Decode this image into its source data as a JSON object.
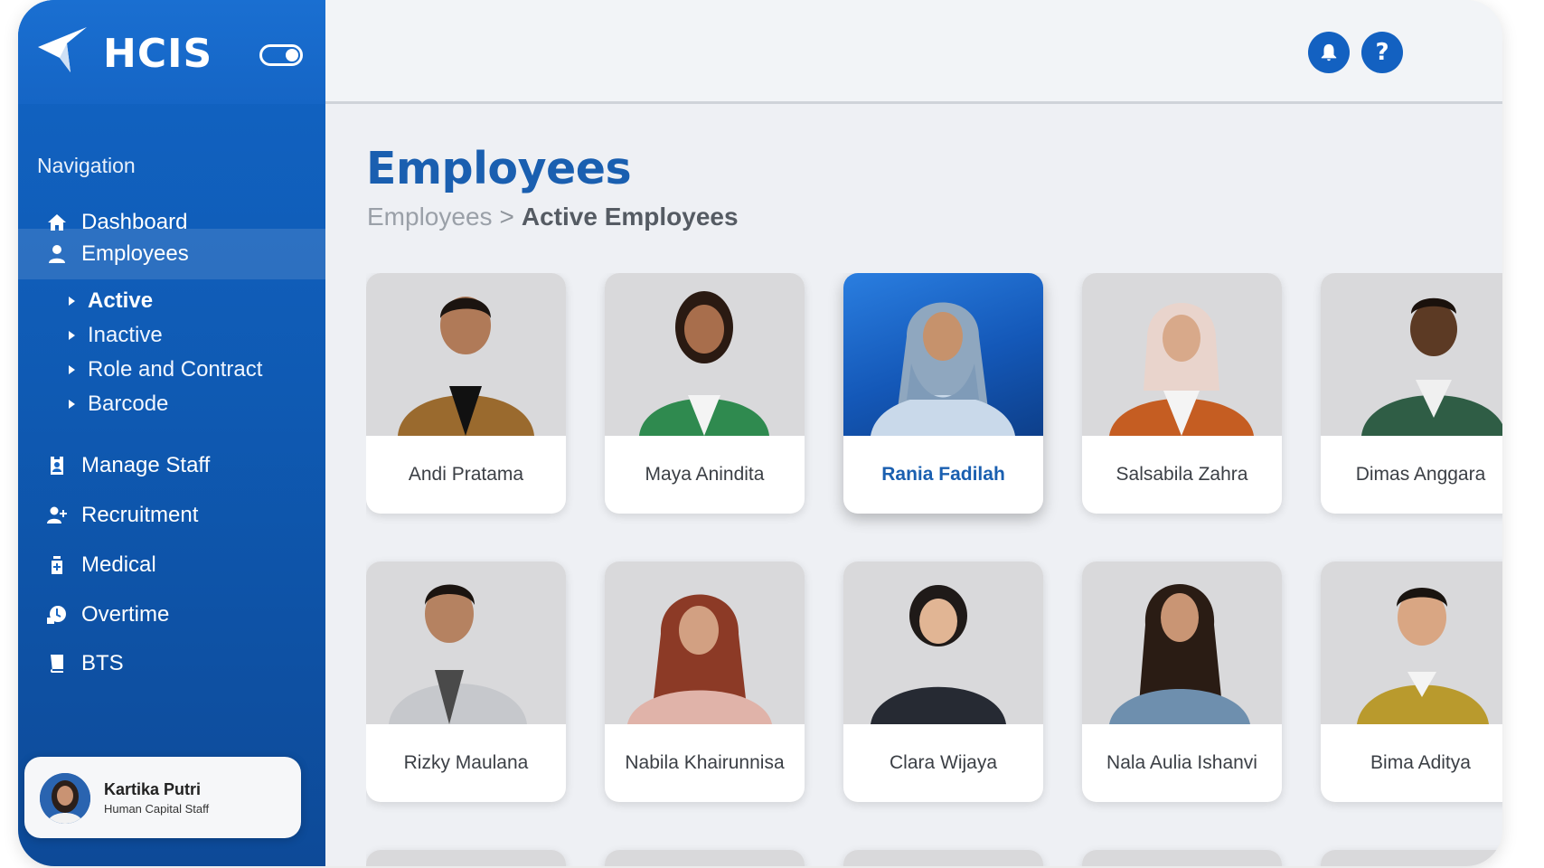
{
  "brand": {
    "name": "HCIS"
  },
  "sidebar": {
    "heading": "Navigation",
    "items": [
      {
        "label": "Dashboard",
        "icon": "home-icon"
      },
      {
        "label": "Employees",
        "icon": "person-icon",
        "active": true
      },
      {
        "label": "Manage Staff",
        "icon": "id-badge-icon"
      },
      {
        "label": "Recruitment",
        "icon": "person-add-icon"
      },
      {
        "label": "Medical",
        "icon": "medical-bottle-icon"
      },
      {
        "label": "Overtime",
        "icon": "clock-money-icon"
      },
      {
        "label": "BTS",
        "icon": "book-icon"
      }
    ],
    "sub_items": [
      {
        "label": "Active",
        "selected": true
      },
      {
        "label": "Inactive"
      },
      {
        "label": "Role and Contract"
      },
      {
        "label": "Barcode"
      }
    ]
  },
  "user": {
    "name": "Kartika Putri",
    "role": "Human Capital Staff"
  },
  "topbar": {
    "help_label": "?"
  },
  "main": {
    "title": "Employees",
    "breadcrumb": {
      "parent": "Employees",
      "separator": ">",
      "current": "Active Employees"
    },
    "employees": [
      {
        "name": "Andi Pratama"
      },
      {
        "name": "Maya Anindita"
      },
      {
        "name": "Rania Fadilah",
        "highlighted": true
      },
      {
        "name": "Salsabila Zahra"
      },
      {
        "name": "Dimas Anggara"
      },
      {
        "name": "Rizky Maulana"
      },
      {
        "name": "Nabila Khairunnisa"
      },
      {
        "name": "Clara Wijaya"
      },
      {
        "name": "Nala Aulia Ishanvi"
      },
      {
        "name": "Bima Aditya"
      }
    ]
  },
  "colors": {
    "primary": "#1361c1",
    "sidebar": "#0f5ab3",
    "title": "#1a5fb0",
    "background": "#eef0f4"
  }
}
